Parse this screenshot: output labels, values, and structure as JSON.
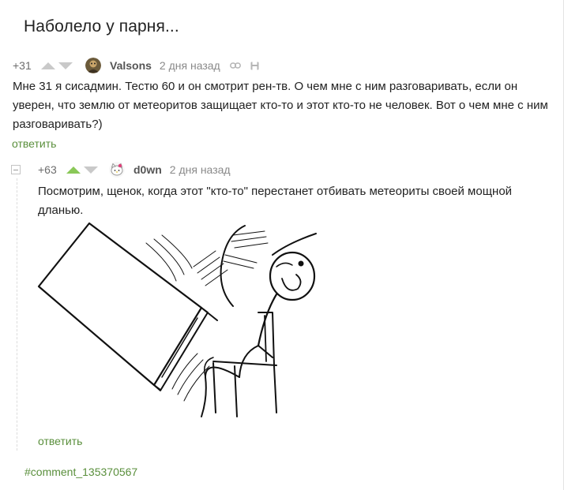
{
  "post": {
    "title": "Наболело у парня..."
  },
  "comment": {
    "rating": "+31",
    "author": "Valsons",
    "time": "2 дня назад",
    "text": "Мне 31 я сисадмин. Тестю 60 и он смотрит рен-тв. О чем мне с ним разговаривать, если он уверен, что землю от метеоритов защищает кто-то и этот кто-то не человек. Вот о чем мне с ним разговаривать?)",
    "reply_label": "ответить",
    "icons": [
      "link-icon",
      "save-icon"
    ]
  },
  "reply_comment": {
    "rating": "+63",
    "author": "d0wn",
    "time": "2 дня назад",
    "text": "Посмотрим, щенок, когда этот \"кто-то\" перестанет отбивать метеориты своей мощной дланью.",
    "reply_label": "ответить",
    "image": "table-flip-meme"
  },
  "footer": {
    "tag": "#comment_135370567"
  },
  "colors": {
    "accent": "#5a8f3c",
    "upvote_active": "#8ac858",
    "vote_inactive": "#c9c9c9"
  }
}
